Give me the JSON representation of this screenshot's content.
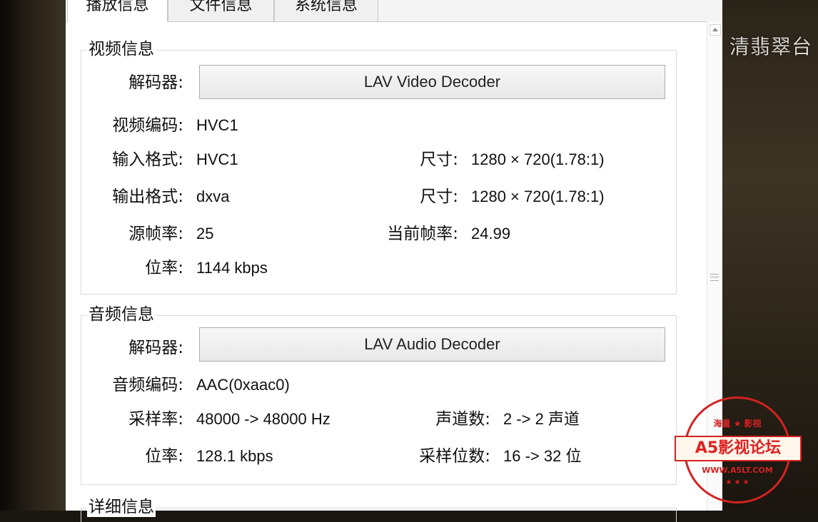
{
  "tabs": [
    {
      "label": "播放信息",
      "active": true
    },
    {
      "label": "文件信息",
      "active": false
    },
    {
      "label": "系统信息",
      "active": false
    }
  ],
  "video": {
    "title": "视频信息",
    "decoder_label": "解码器:",
    "decoder_value": "LAV Video Decoder",
    "codec_label": "视频编码:",
    "codec_value": "HVC1",
    "input_label": "输入格式:",
    "input_value": "HVC1",
    "input_size_label": "尺寸:",
    "input_size_value": "1280 × 720(1.78:1)",
    "output_label": "输出格式:",
    "output_value": "dxva",
    "output_size_label": "尺寸:",
    "output_size_value": "1280 × 720(1.78:1)",
    "src_fps_label": "源帧率:",
    "src_fps_value": "25",
    "cur_fps_label": "当前帧率:",
    "cur_fps_value": "24.99",
    "bitrate_label": "位率:",
    "bitrate_value": "1144 kbps"
  },
  "audio": {
    "title": "音频信息",
    "decoder_label": "解码器:",
    "decoder_value": "LAV Audio Decoder",
    "codec_label": "音频编码:",
    "codec_value": "AAC(0xaac0)",
    "sample_rate_label": "采样率:",
    "sample_rate_value": "48000 -> 48000 Hz",
    "channels_label": "声道数:",
    "channels_value": "2 -> 2 声道",
    "bitrate_label": "位率:",
    "bitrate_value": "128.1 kbps",
    "bit_depth_label": "采样位数:",
    "bit_depth_value": "16 -> 32 位"
  },
  "details": {
    "title": "详细信息"
  },
  "background": {
    "channel_logo": "清翡翠台"
  },
  "watermark": {
    "top_text": "海量 ★ 影视",
    "banner_text": "A5影视论坛",
    "url_text": "WWW.A5LT.COM",
    "stars": "★ ★ ★"
  }
}
